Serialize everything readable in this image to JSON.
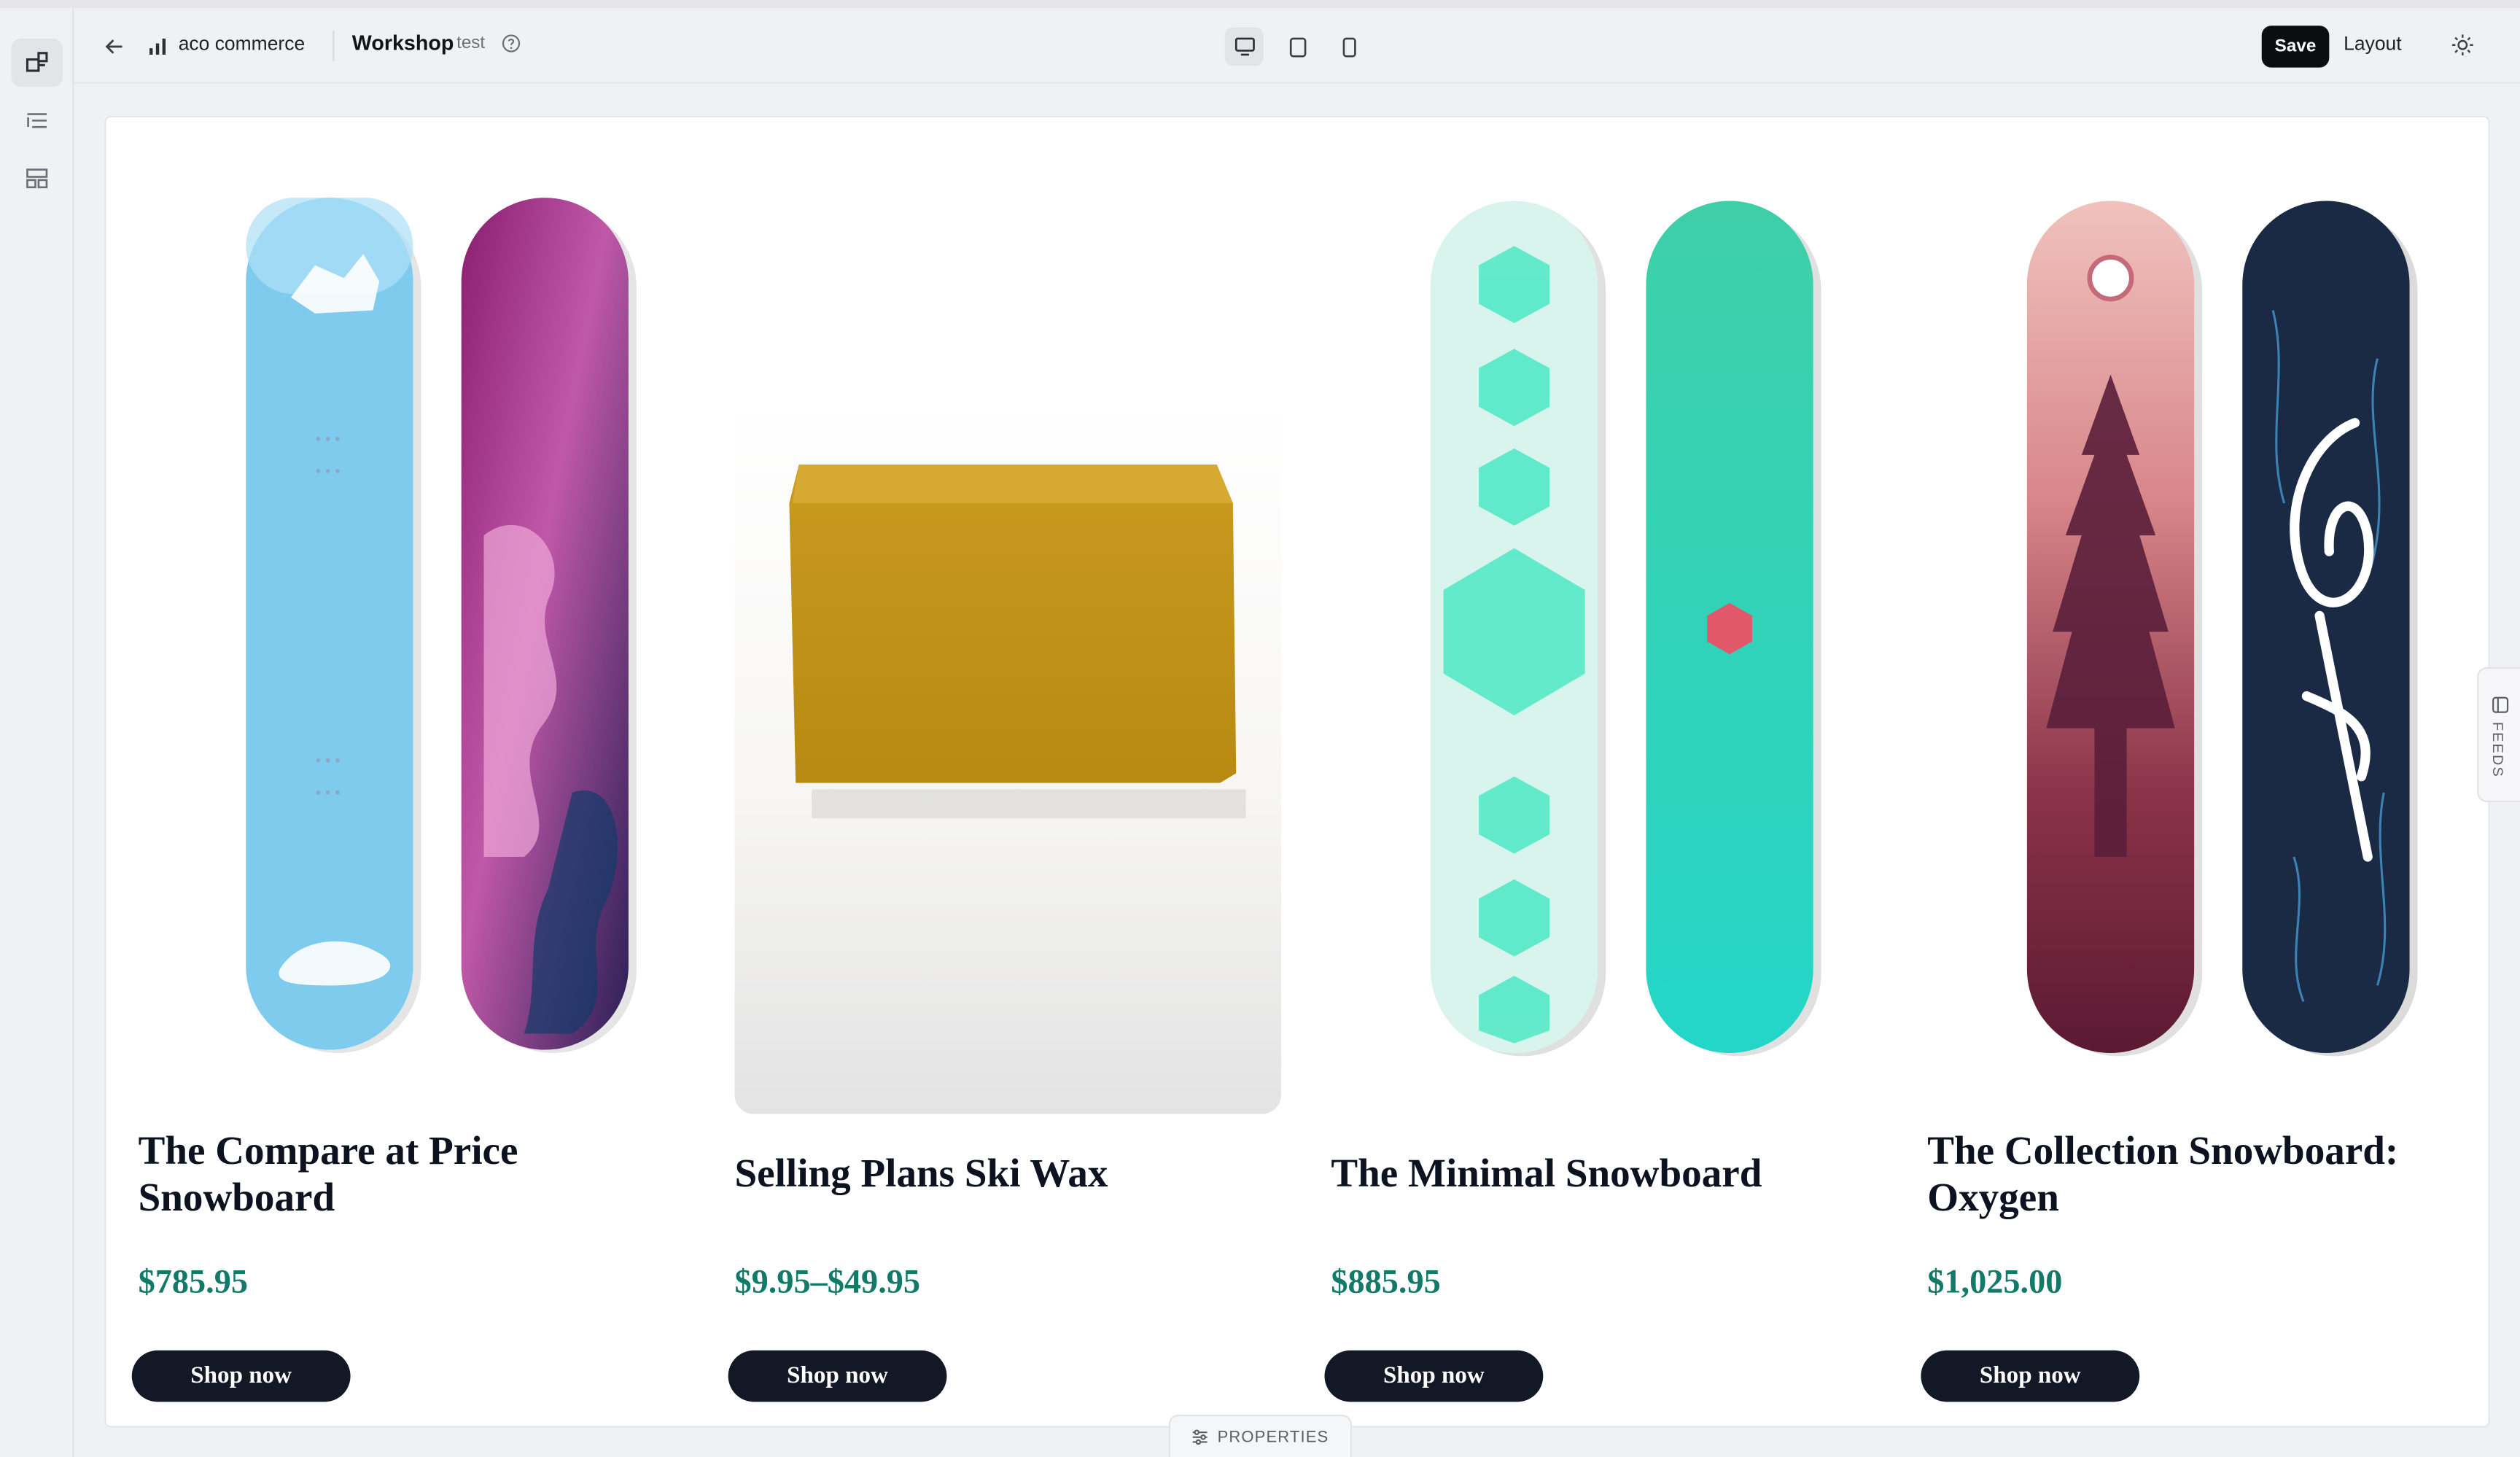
{
  "store": {
    "name": "aco commerce"
  },
  "page": {
    "title": "Workshop",
    "subtitle": "test"
  },
  "toolbar": {
    "save_label": "Save",
    "layout_label": "Layout"
  },
  "icons": {
    "rail": [
      "sections-icon",
      "outline-list-icon",
      "templates-icon"
    ],
    "devices": [
      "desktop-icon",
      "tablet-icon",
      "mobile-icon"
    ],
    "other": [
      "back-arrow-icon",
      "bar-chart-icon",
      "help-circle-icon",
      "sun-icon",
      "feeds-icon",
      "properties-icon"
    ]
  },
  "colors": {
    "price": "#137a6a",
    "button": "#121826",
    "save": "#0b0d10"
  },
  "products": [
    {
      "name": "The Compare at Price Snowboard",
      "price": "$785.95",
      "cta": "Shop now"
    },
    {
      "name": "Selling Plans Ski Wax",
      "price": "$9.95–$49.95",
      "cta": "Shop now"
    },
    {
      "name": "The Minimal Snowboard",
      "price": "$885.95",
      "cta": "Shop now"
    },
    {
      "name": "The Collection Snowboard: Oxygen",
      "price": "$1,025.00",
      "cta": "Shop now"
    }
  ],
  "side_tabs": {
    "feeds_label": "FEEDS",
    "properties_label": "PROPERTIES"
  }
}
